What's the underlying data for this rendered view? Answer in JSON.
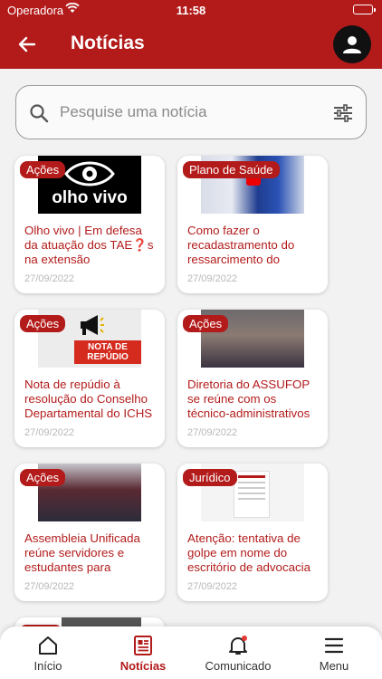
{
  "status": {
    "carrier": "Operadora",
    "time": "11:58"
  },
  "header": {
    "title": "Notícias"
  },
  "search": {
    "placeholder": "Pesquise uma notícia"
  },
  "news": [
    {
      "tag": "Ações",
      "title": "Olho vivo | Em defesa da atuação dos TAE❓s na extensão",
      "date": "27/09/2022",
      "thumb_text": "olho vivo"
    },
    {
      "tag": "Plano de Saúde",
      "title": "Como fazer o recadastramento do ressarcimento do plano...",
      "date": "27/09/2022"
    },
    {
      "tag": "Ações",
      "title": "Nota de repúdio à resolução do Conselho Departamental do ICHS",
      "date": "27/09/2022",
      "thumb_text": "NOTA DE REPÚDIO"
    },
    {
      "tag": "Ações",
      "title": "Diretoria do ASSUFOP se reúne com os técnico-administrativos do ICSA",
      "date": "27/09/2022"
    },
    {
      "tag": "Ações",
      "title": "Assembleia Unificada reúne servidores e estudantes para debate...",
      "date": "27/09/2022"
    },
    {
      "tag": "Jurídico",
      "title": "Atenção: tentativa de golpe em nome do escritório de advocacia ...",
      "date": "27/09/2022"
    }
  ],
  "tabs": [
    {
      "label": "Início",
      "icon": "home-icon"
    },
    {
      "label": "Notícias",
      "icon": "newspaper-icon",
      "active": true
    },
    {
      "label": "Comunicado",
      "icon": "bell-icon"
    },
    {
      "label": "Menu",
      "icon": "menu-icon"
    }
  ],
  "colors": {
    "primary": "#b31b1b",
    "background": "#f2f2f2"
  }
}
